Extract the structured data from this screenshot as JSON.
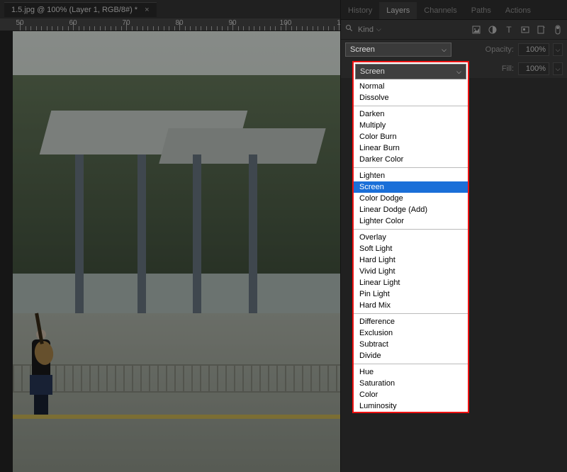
{
  "document": {
    "tab_title": "1.5.jpg @ 100% (Layer 1, RGB/8#) *",
    "ruler_ticks": [
      "50",
      "60",
      "70",
      "80",
      "90",
      "100"
    ]
  },
  "panel": {
    "tabs": [
      "History",
      "Layers",
      "Channels",
      "Paths",
      "Actions"
    ],
    "active_tab_index": 1,
    "filter_label": "Kind",
    "opacity_label": "Opacity:",
    "opacity_value": "100%",
    "fill_label": "Fill:",
    "fill_value": "100%"
  },
  "blend_mode": {
    "current": "Screen",
    "groups": [
      [
        "Normal",
        "Dissolve"
      ],
      [
        "Darken",
        "Multiply",
        "Color Burn",
        "Linear Burn",
        "Darker Color"
      ],
      [
        "Lighten",
        "Screen",
        "Color Dodge",
        "Linear Dodge (Add)",
        "Lighter Color"
      ],
      [
        "Overlay",
        "Soft Light",
        "Hard Light",
        "Vivid Light",
        "Linear Light",
        "Pin Light",
        "Hard Mix"
      ],
      [
        "Difference",
        "Exclusion",
        "Subtract",
        "Divide"
      ],
      [
        "Hue",
        "Saturation",
        "Color",
        "Luminosity"
      ]
    ],
    "selected": "Screen"
  }
}
